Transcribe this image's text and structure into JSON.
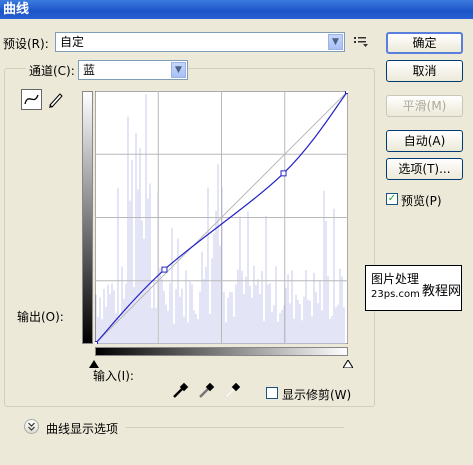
{
  "window": {
    "title": "曲线"
  },
  "preset": {
    "label": "预设(R):",
    "value": "自定"
  },
  "channel": {
    "label": "通道(C):",
    "value": "蓝"
  },
  "buttons": {
    "ok": "确定",
    "cancel": "取消",
    "smooth": "平滑(M)",
    "auto": "自动(A)",
    "options": "选项(T)..."
  },
  "preview": {
    "label": "预览(P)",
    "checked": true
  },
  "output_label": "输出(O):",
  "input_label": "输入(I):",
  "show_clipping": {
    "label": "显示修剪(W)",
    "checked": false
  },
  "curve_display_options": "曲线显示选项",
  "watermark": {
    "line1": "图片处理",
    "line2": "23ps.com",
    "line3": "教程网"
  },
  "curve": {
    "channel_color": "#2323c8",
    "control_points": [
      [
        0,
        0
      ],
      [
        70,
        75
      ],
      [
        190,
        172
      ],
      [
        255,
        255
      ]
    ]
  }
}
